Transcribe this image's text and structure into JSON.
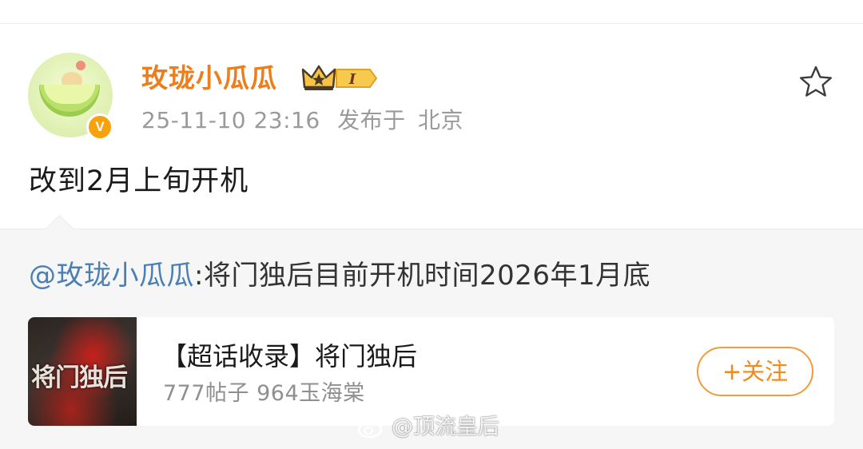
{
  "post": {
    "username": "玫珑小瓜瓜",
    "level_badge": "I",
    "timestamp": "25-11-10 23:16",
    "published_label": "发布于",
    "location": "北京",
    "text": "改到2月上旬开机"
  },
  "repost": {
    "mention": "@玫珑小瓜瓜",
    "text": ":将门独后目前开机时间2026年1月底"
  },
  "topic_card": {
    "thumbnail_title": "将门独后",
    "title": "【超话收录】将门独后",
    "stats": "777帖子 964玉海棠",
    "follow_label": "+关注"
  },
  "watermark": {
    "text": "@顶流皇后"
  },
  "icons": {
    "favorite": "star-outline-icon",
    "verified": "verified-v-icon",
    "crown": "crown-icon",
    "weibo": "weibo-logo-icon"
  },
  "colors": {
    "username": "#ec7e1e",
    "mention": "#4a7fb6",
    "follow": "#f08a1c",
    "verified_badge": "#f7a20c"
  }
}
